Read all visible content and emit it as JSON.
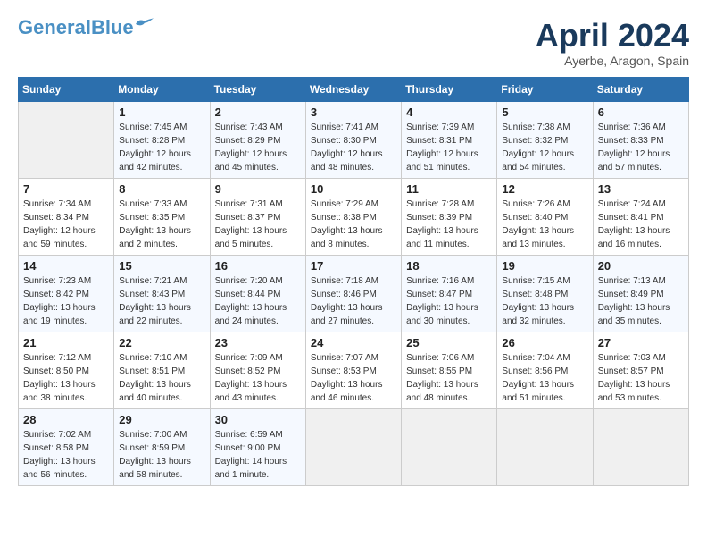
{
  "logo": {
    "line1": "General",
    "line2": "Blue"
  },
  "title": "April 2024",
  "subtitle": "Ayerbe, Aragon, Spain",
  "days_of_week": [
    "Sunday",
    "Monday",
    "Tuesday",
    "Wednesday",
    "Thursday",
    "Friday",
    "Saturday"
  ],
  "weeks": [
    [
      {
        "day": "",
        "info": ""
      },
      {
        "day": "1",
        "info": "Sunrise: 7:45 AM\nSunset: 8:28 PM\nDaylight: 12 hours\nand 42 minutes."
      },
      {
        "day": "2",
        "info": "Sunrise: 7:43 AM\nSunset: 8:29 PM\nDaylight: 12 hours\nand 45 minutes."
      },
      {
        "day": "3",
        "info": "Sunrise: 7:41 AM\nSunset: 8:30 PM\nDaylight: 12 hours\nand 48 minutes."
      },
      {
        "day": "4",
        "info": "Sunrise: 7:39 AM\nSunset: 8:31 PM\nDaylight: 12 hours\nand 51 minutes."
      },
      {
        "day": "5",
        "info": "Sunrise: 7:38 AM\nSunset: 8:32 PM\nDaylight: 12 hours\nand 54 minutes."
      },
      {
        "day": "6",
        "info": "Sunrise: 7:36 AM\nSunset: 8:33 PM\nDaylight: 12 hours\nand 57 minutes."
      }
    ],
    [
      {
        "day": "7",
        "info": "Sunrise: 7:34 AM\nSunset: 8:34 PM\nDaylight: 12 hours\nand 59 minutes."
      },
      {
        "day": "8",
        "info": "Sunrise: 7:33 AM\nSunset: 8:35 PM\nDaylight: 13 hours\nand 2 minutes."
      },
      {
        "day": "9",
        "info": "Sunrise: 7:31 AM\nSunset: 8:37 PM\nDaylight: 13 hours\nand 5 minutes."
      },
      {
        "day": "10",
        "info": "Sunrise: 7:29 AM\nSunset: 8:38 PM\nDaylight: 13 hours\nand 8 minutes."
      },
      {
        "day": "11",
        "info": "Sunrise: 7:28 AM\nSunset: 8:39 PM\nDaylight: 13 hours\nand 11 minutes."
      },
      {
        "day": "12",
        "info": "Sunrise: 7:26 AM\nSunset: 8:40 PM\nDaylight: 13 hours\nand 13 minutes."
      },
      {
        "day": "13",
        "info": "Sunrise: 7:24 AM\nSunset: 8:41 PM\nDaylight: 13 hours\nand 16 minutes."
      }
    ],
    [
      {
        "day": "14",
        "info": "Sunrise: 7:23 AM\nSunset: 8:42 PM\nDaylight: 13 hours\nand 19 minutes."
      },
      {
        "day": "15",
        "info": "Sunrise: 7:21 AM\nSunset: 8:43 PM\nDaylight: 13 hours\nand 22 minutes."
      },
      {
        "day": "16",
        "info": "Sunrise: 7:20 AM\nSunset: 8:44 PM\nDaylight: 13 hours\nand 24 minutes."
      },
      {
        "day": "17",
        "info": "Sunrise: 7:18 AM\nSunset: 8:46 PM\nDaylight: 13 hours\nand 27 minutes."
      },
      {
        "day": "18",
        "info": "Sunrise: 7:16 AM\nSunset: 8:47 PM\nDaylight: 13 hours\nand 30 minutes."
      },
      {
        "day": "19",
        "info": "Sunrise: 7:15 AM\nSunset: 8:48 PM\nDaylight: 13 hours\nand 32 minutes."
      },
      {
        "day": "20",
        "info": "Sunrise: 7:13 AM\nSunset: 8:49 PM\nDaylight: 13 hours\nand 35 minutes."
      }
    ],
    [
      {
        "day": "21",
        "info": "Sunrise: 7:12 AM\nSunset: 8:50 PM\nDaylight: 13 hours\nand 38 minutes."
      },
      {
        "day": "22",
        "info": "Sunrise: 7:10 AM\nSunset: 8:51 PM\nDaylight: 13 hours\nand 40 minutes."
      },
      {
        "day": "23",
        "info": "Sunrise: 7:09 AM\nSunset: 8:52 PM\nDaylight: 13 hours\nand 43 minutes."
      },
      {
        "day": "24",
        "info": "Sunrise: 7:07 AM\nSunset: 8:53 PM\nDaylight: 13 hours\nand 46 minutes."
      },
      {
        "day": "25",
        "info": "Sunrise: 7:06 AM\nSunset: 8:55 PM\nDaylight: 13 hours\nand 48 minutes."
      },
      {
        "day": "26",
        "info": "Sunrise: 7:04 AM\nSunset: 8:56 PM\nDaylight: 13 hours\nand 51 minutes."
      },
      {
        "day": "27",
        "info": "Sunrise: 7:03 AM\nSunset: 8:57 PM\nDaylight: 13 hours\nand 53 minutes."
      }
    ],
    [
      {
        "day": "28",
        "info": "Sunrise: 7:02 AM\nSunset: 8:58 PM\nDaylight: 13 hours\nand 56 minutes."
      },
      {
        "day": "29",
        "info": "Sunrise: 7:00 AM\nSunset: 8:59 PM\nDaylight: 13 hours\nand 58 minutes."
      },
      {
        "day": "30",
        "info": "Sunrise: 6:59 AM\nSunset: 9:00 PM\nDaylight: 14 hours\nand 1 minute."
      },
      {
        "day": "",
        "info": ""
      },
      {
        "day": "",
        "info": ""
      },
      {
        "day": "",
        "info": ""
      },
      {
        "day": "",
        "info": ""
      }
    ]
  ]
}
